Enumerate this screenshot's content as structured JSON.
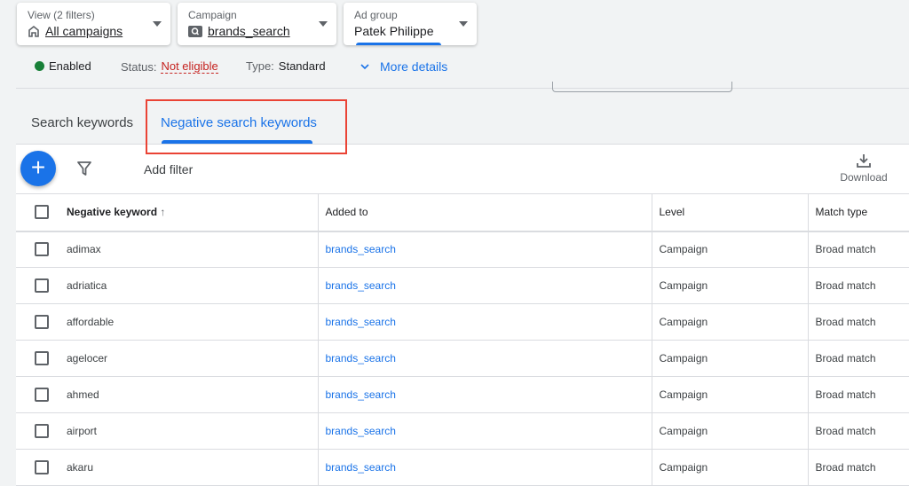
{
  "selectors": [
    {
      "label": "View (2 filters)",
      "value": "All campaigns",
      "icon": "home-icon"
    },
    {
      "label": "Campaign",
      "value": "brands_search",
      "icon": "search-campaign-icon"
    },
    {
      "label": "Ad group",
      "value": "Patek Philippe"
    }
  ],
  "status": {
    "enabled": "Enabled",
    "status_label": "Status:",
    "status_value": "Not eligible",
    "type_label": "Type:",
    "type_value": "Standard",
    "more_details": "More details"
  },
  "tabs": [
    {
      "label": "Search keywords"
    },
    {
      "label": "Negative search keywords",
      "active": true
    }
  ],
  "toolbar": {
    "add_filter": "Add filter",
    "download": "Download"
  },
  "table": {
    "headers": [
      "Negative keyword",
      "Added to",
      "Level",
      "Match type"
    ],
    "rows": [
      [
        "adimax",
        "brands_search",
        "Campaign",
        "Broad match"
      ],
      [
        "adriatica",
        "brands_search",
        "Campaign",
        "Broad match"
      ],
      [
        "affordable",
        "brands_search",
        "Campaign",
        "Broad match"
      ],
      [
        "agelocer",
        "brands_search",
        "Campaign",
        "Broad match"
      ],
      [
        "ahmed",
        "brands_search",
        "Campaign",
        "Broad match"
      ],
      [
        "airport",
        "brands_search",
        "Campaign",
        "Broad match"
      ],
      [
        "akaru",
        "brands_search",
        "Campaign",
        "Broad match"
      ]
    ]
  },
  "colors": {
    "accent": "#1a73e8",
    "enabled": "#188038",
    "error": "#c5221f",
    "highlight_box": "#ea4335"
  }
}
